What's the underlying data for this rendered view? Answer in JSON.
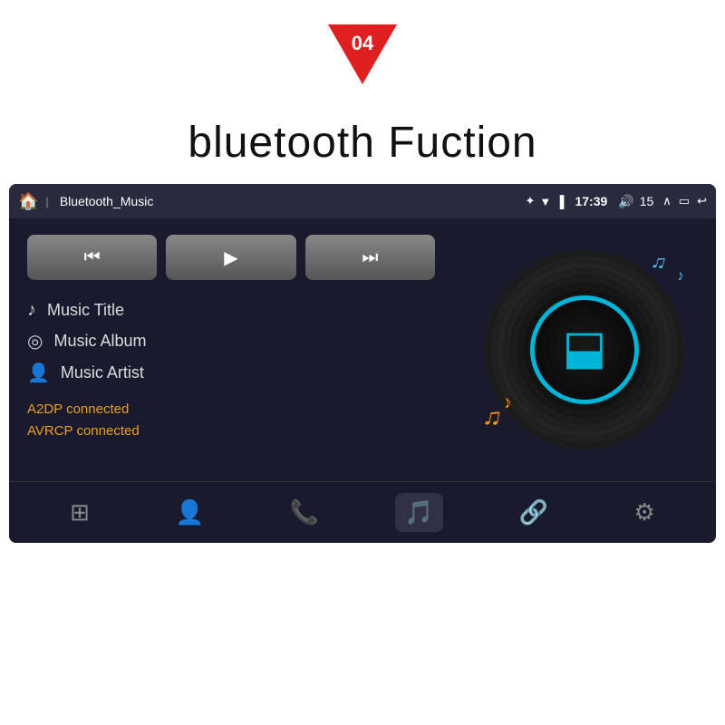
{
  "badge": {
    "number": "04"
  },
  "title": "bluetooth Fuction",
  "status_bar": {
    "app_name": "Bluetooth_Music",
    "time": "17:39",
    "volume_icon": "🔊",
    "volume_level": "15"
  },
  "controls": {
    "prev_label": "⏮",
    "play_label": "▶",
    "next_label": "⏭"
  },
  "info": {
    "title_icon": "♪",
    "title_label": "Music Title",
    "album_icon": "◎",
    "album_label": "Music Album",
    "artist_icon": "👤",
    "artist_label": "Music Artist"
  },
  "connection": {
    "a2dp": "A2DP connected",
    "avrcp": "AVRCP connected"
  },
  "nav": {
    "items": [
      {
        "icon": "⊞",
        "label": "grid",
        "active": false
      },
      {
        "icon": "👤",
        "label": "contacts",
        "active": false
      },
      {
        "icon": "📞",
        "label": "phone",
        "active": false
      },
      {
        "icon": "🎵",
        "label": "music",
        "active": true
      },
      {
        "icon": "🔗",
        "label": "link",
        "active": false
      },
      {
        "icon": "⚙",
        "label": "settings",
        "active": false
      }
    ]
  }
}
